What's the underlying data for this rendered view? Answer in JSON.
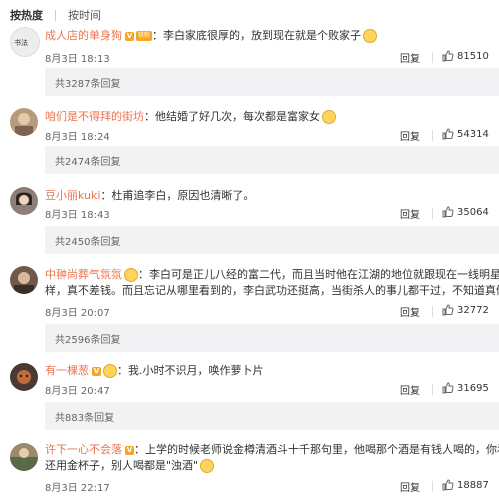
{
  "sort": {
    "hot": "按热度",
    "time": "按时间"
  },
  "comments": [
    {
      "user": "成人店的单身狗",
      "has_fan_badge": true,
      "fan_badge": "铁粉",
      "text": "：李白家底很厚的，放到现在就是个败家子",
      "text2": "",
      "date": "8月3日 18:13",
      "reply": "回复",
      "likes": "81510",
      "reply_count": "共3287条回复",
      "avatar_color": "#c9c9c9"
    },
    {
      "user": "咱们是不得拜的街坊",
      "text": "：他结婚了好几次，每次都是富家女",
      "text2": "",
      "date": "8月3日 18:24",
      "reply": "回复",
      "likes": "54314",
      "reply_count": "共2474条回复",
      "avatar_color": "#b89a7d"
    },
    {
      "user": "豆小丽kuki",
      "text": "：杜甫追李白，原因也清晰了。",
      "text2": "",
      "date": "8月3日 18:43",
      "reply": "回复",
      "likes": "35064",
      "reply_count": "共2450条回复",
      "avatar_color": "#8d7f78"
    },
    {
      "user": "中翀尚葬气氛氛",
      "text": "：李白可是正儿八经的富二代，而且当时他在江湖的地位就跟现在一线明星一",
      "text2": "样，真不差钱。而且忘记从哪里看到的，李白武功还挺高，当街杀人的事儿都干过，不知道真假",
      "date": "8月3日 20:07",
      "reply": "回复",
      "likes": "32772",
      "reply_count": "共2596条回复",
      "avatar_color": "#6e5a4c"
    },
    {
      "user": "有一棵葱",
      "text": "：我.小时不识月，唤作萝卜片",
      "text2": "",
      "date": "8月3日 20:47",
      "reply": "回复",
      "likes": "31695",
      "reply_count": "共883条回复",
      "avatar_color": "#4a3a32"
    },
    {
      "user": "许下一心不会落",
      "text": "：上学的时候老师说金樽清酒斗十千那句里，他喝那个酒是有钱人喝的，你看",
      "text2": "还用金杯子，别人喝都是\"浊酒\"",
      "date": "8月3日 22:17",
      "reply": "回复",
      "likes": "18887",
      "reply_count": "",
      "avatar_color": "#9a8a6b"
    }
  ],
  "colors": {
    "username": "#eb7350",
    "badge": "#f5a623",
    "reply_bg": "#f2f2f5"
  },
  "icons": {
    "like": "thumbs-up-icon",
    "emoji": "smiley-emoji-icon",
    "vip": "v-badge-icon"
  }
}
